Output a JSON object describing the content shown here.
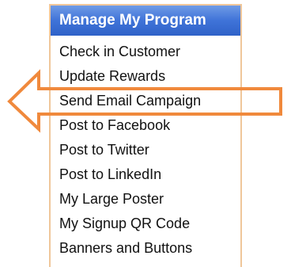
{
  "panel": {
    "title": "Manage My Program",
    "items": [
      {
        "label": "Check in Customer"
      },
      {
        "label": "Update Rewards"
      },
      {
        "label": "Send Email Campaign"
      },
      {
        "label": "Post to Facebook"
      },
      {
        "label": "Post to Twitter"
      },
      {
        "label": "Post to LinkedIn"
      },
      {
        "label": "My Large Poster"
      },
      {
        "label": "My Signup QR Code"
      },
      {
        "label": "Banners and Buttons"
      }
    ]
  },
  "annotation": {
    "icon": "left-arrow-icon",
    "color": "#f0893c",
    "points_to": "Send Email Campaign"
  },
  "colors": {
    "header_background": "#3f73d8",
    "header_text": "#ffffff",
    "panel_border": "#f0c79a",
    "item_text": "#111111"
  }
}
